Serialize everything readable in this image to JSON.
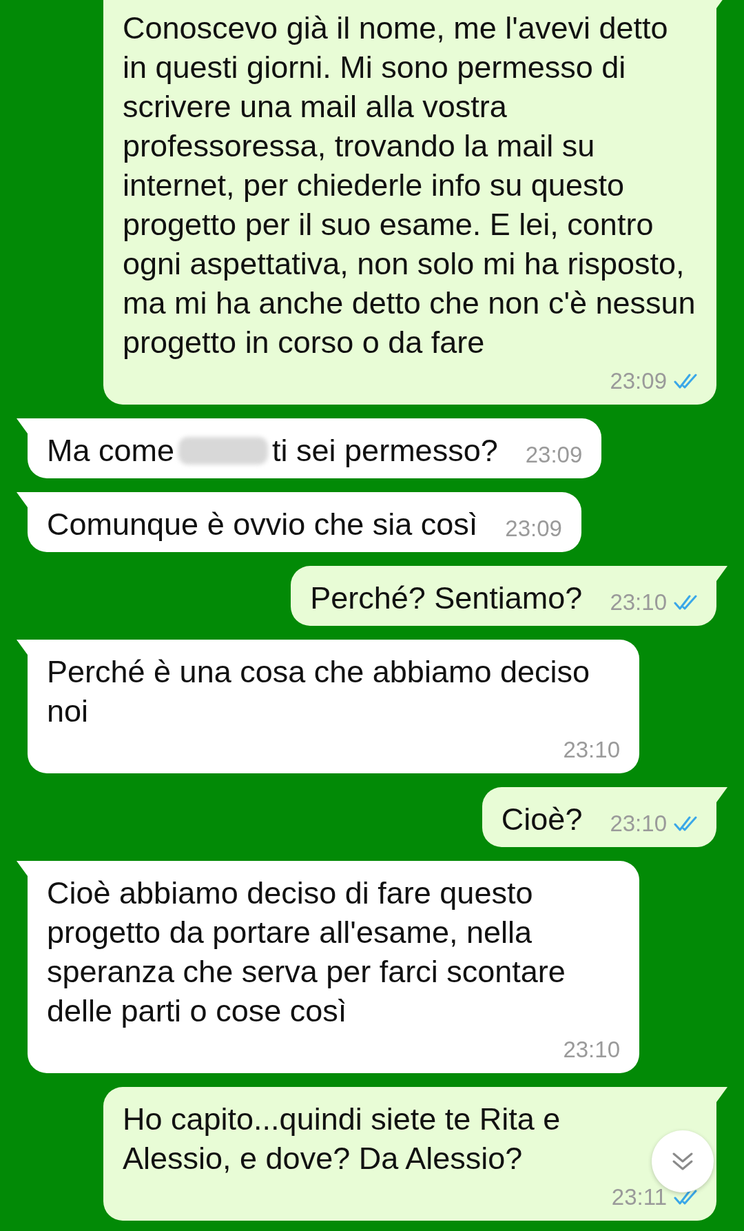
{
  "messages": [
    {
      "kind": "outgoing",
      "segments": [
        {
          "kind": "text",
          "text": "Conoscevo già il nome, me l'avevi detto in questi giorni. Mi sono permesso di scrivere una mail alla vostra professoressa, trovando la mail su internet, per chiederle info su questo progetto per il suo esame. E lei, contro ogni aspettativa, non solo mi ha risposto, ma mi ha anche detto che non c'è nessun progetto in corso o da fare"
        }
      ],
      "time": "23:09",
      "read": true
    },
    {
      "kind": "incoming",
      "segments": [
        {
          "kind": "text",
          "text": "Ma come"
        },
        {
          "kind": "redacted"
        },
        {
          "kind": "text",
          "text": "ti sei permesso?"
        }
      ],
      "time": "23:09"
    },
    {
      "kind": "incoming",
      "segments": [
        {
          "kind": "text",
          "text": "Comunque è ovvio che sia così"
        }
      ],
      "time": "23:09"
    },
    {
      "kind": "outgoing",
      "segments": [
        {
          "kind": "text",
          "text": "Perché? Sentiamo?"
        }
      ],
      "time": "23:10",
      "read": true
    },
    {
      "kind": "incoming",
      "segments": [
        {
          "kind": "text",
          "text": "Perché è una cosa che abbiamo deciso noi"
        }
      ],
      "time": "23:10"
    },
    {
      "kind": "outgoing",
      "segments": [
        {
          "kind": "text",
          "text": "Cioè?"
        }
      ],
      "time": "23:10",
      "read": true
    },
    {
      "kind": "incoming",
      "segments": [
        {
          "kind": "text",
          "text": "Cioè abbiamo deciso di fare questo progetto da portare all'esame, nella speranza che serva per farci scontare delle parti o cose così"
        }
      ],
      "time": "23:10"
    },
    {
      "kind": "outgoing",
      "segments": [
        {
          "kind": "text",
          "text": "Ho capito...quindi siete te Rita e Alessio, e dove? Da Alessio?"
        }
      ],
      "time": "23:11",
      "read": true
    }
  ]
}
